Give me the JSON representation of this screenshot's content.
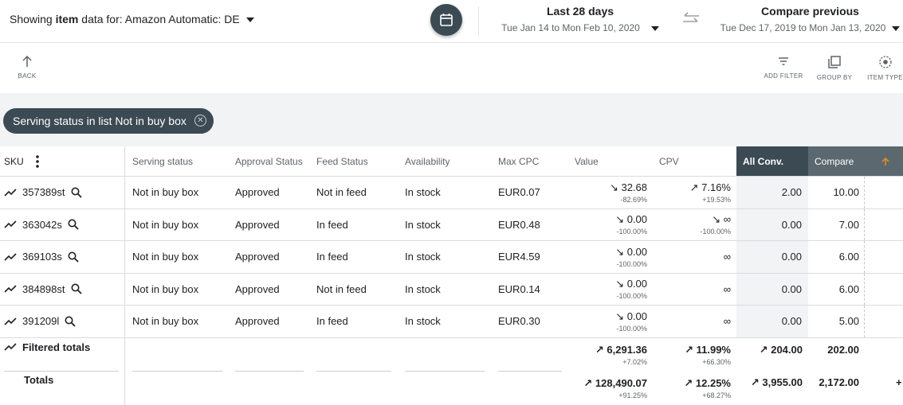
{
  "header": {
    "showing_prefix": "Showing ",
    "showing_item": "item",
    "showing_suffix": " data for: Amazon Automatic: DE",
    "current_range": {
      "title": "Last 28 days",
      "dates": "Tue Jan 14 to Mon Feb 10, 2020"
    },
    "compare_range": {
      "title": "Compare previous",
      "dates": "Tue Dec 17, 2019 to Mon Jan 13, 2020"
    }
  },
  "toolbar": {
    "back": "BACK",
    "add_filter": "ADD FILTER",
    "group_by": "GROUP BY",
    "item_type": "ITEM TYPE"
  },
  "filter_chip": {
    "label": "Serving status in list Not in buy box"
  },
  "table": {
    "columns": {
      "sku": "SKU",
      "serving": "Serving status",
      "approval": "Approval Status",
      "feed": "Feed Status",
      "availability": "Availability",
      "max_cpc": "Max CPC",
      "value": "Value",
      "cpv": "CPV",
      "all_conv": "All Conv.",
      "compare": "Compare"
    },
    "rows": [
      {
        "sku": "357389st",
        "serving": "Not in buy box",
        "approval": "Approved",
        "feed": "Not in feed",
        "availability": "In stock",
        "max_cpc": "EUR0.07",
        "value": "↘ 32.68",
        "value_change": "-82.69%",
        "cpv": "↗ 7.16%",
        "cpv_change": "+19.53%",
        "all_conv": "2.00",
        "compare": "10.00"
      },
      {
        "sku": "363042s",
        "serving": "Not in buy box",
        "approval": "Approved",
        "feed": "In feed",
        "availability": "In stock",
        "max_cpc": "EUR0.48",
        "value": "↘ 0.00",
        "value_change": "-100.00%",
        "cpv": "↘ ∞",
        "cpv_change": "-100.00%",
        "all_conv": "0.00",
        "compare": "7.00"
      },
      {
        "sku": "369103s",
        "serving": "Not in buy box",
        "approval": "Approved",
        "feed": "In feed",
        "availability": "In stock",
        "max_cpc": "EUR4.59",
        "value": "↘ 0.00",
        "value_change": "-100.00%",
        "cpv": "∞",
        "cpv_change": "",
        "all_conv": "0.00",
        "compare": "6.00"
      },
      {
        "sku": "384898st",
        "serving": "Not in buy box",
        "approval": "Approved",
        "feed": "Not in feed",
        "availability": "In stock",
        "max_cpc": "EUR0.14",
        "value": "↘ 0.00",
        "value_change": "-100.00%",
        "cpv": "∞",
        "cpv_change": "",
        "all_conv": "0.00",
        "compare": "6.00"
      },
      {
        "sku": "391209l",
        "serving": "Not in buy box",
        "approval": "Approved",
        "feed": "In feed",
        "availability": "In stock",
        "max_cpc": "EUR0.30",
        "value": "↘ 0.00",
        "value_change": "-100.00%",
        "cpv": "∞",
        "cpv_change": "",
        "all_conv": "0.00",
        "compare": "5.00"
      }
    ],
    "filtered_totals": {
      "label": "Filtered totals",
      "value": "↗ 6,291.36",
      "value_change": "+7.02%",
      "cpv": "↗ 11.99%",
      "cpv_change": "+66.30%",
      "all_conv": "↗ 204.00",
      "compare": "202.00"
    },
    "totals": {
      "label": "Totals",
      "value": "↗ 128,490.07",
      "value_change": "+91.25%",
      "cpv": "↗ 12.25%",
      "cpv_change": "+68.27%",
      "all_conv": "↗ 3,955.00",
      "compare": "2,172.00",
      "edge": "+"
    }
  },
  "colors": {
    "dark_header": "#3c4a54",
    "sort_arrow": "#e8891e",
    "chip_bg": "#3c4a54"
  },
  "icons": [
    "calendar-icon",
    "swap-icon",
    "back-arrow-icon",
    "filter-icon",
    "group-by-icon",
    "item-type-icon",
    "more-vert-icon",
    "trend-icon",
    "search-icon",
    "close-circle-icon",
    "sort-up-icon"
  ]
}
